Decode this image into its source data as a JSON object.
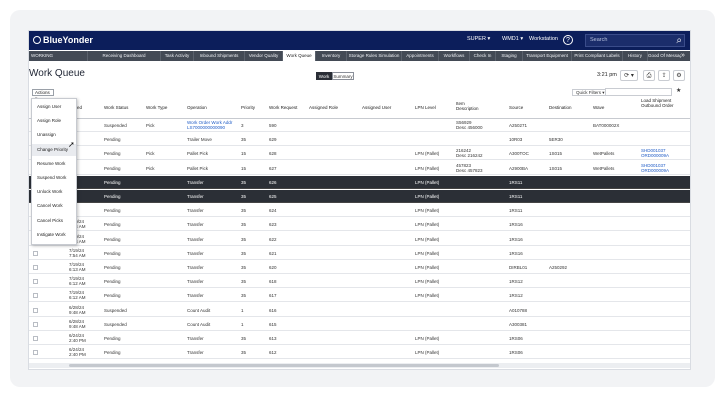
{
  "topbar": {
    "logo": "BlueYonder",
    "user": "SUPER ▾",
    "warehouse": "WMD1 ▾",
    "workstation": "Workstation",
    "help": "?",
    "search_placeholder": "Search"
  },
  "nav": {
    "left_label": "WORKING",
    "tabs": [
      "Receiving Dashboard",
      "Task Activity",
      "Inbound Shipments",
      "Vendor Quality",
      "Work Queue",
      "Inventory",
      "Storage Rules Simulation",
      "Appointments",
      "Workflows",
      "Check In",
      "Staging",
      "Transport Equipment",
      "Print Compliant Labels",
      "History",
      "Good Of Message"
    ],
    "active_tab": "Work Queue",
    "more": "»"
  },
  "page": {
    "title": "Work Queue",
    "view_work": "Work",
    "view_summary": "Summary",
    "time": "3:21 pm",
    "actions_label": "Actions ▾",
    "quick_filters": "Quick Filters ▾"
  },
  "columns": [
    "Added",
    "Work Status",
    "Work Type",
    "Operation",
    "Priority",
    "Work Request",
    "Assigned Role",
    "Assigned User",
    "LPN Level",
    "Item Description",
    "Source",
    "Destination",
    "Wave",
    "Load Shipment Outbound Order"
  ],
  "actions_menu": [
    "Assign User",
    "Assign Role",
    "Unassign",
    "Change Priority",
    "Resume Work",
    "Suspend Work",
    "Unlock Work",
    "Cancel Work",
    "Cancel Picks",
    "Instigate Work"
  ],
  "rows": [
    {
      "added": "PM",
      "status": "Suspended",
      "type": "Pick",
      "operation": "Work Order Work Addr",
      "operation2": "LS7000000000090",
      "priority": "3",
      "request": "590",
      "lpn": "",
      "item": "S56929",
      "item2": "Desc 456000",
      "source": "A250271",
      "dest": "",
      "wave": "BAT000002X",
      "order": "",
      "order2": "",
      "selected": false
    },
    {
      "added": "PM",
      "status": "Pending",
      "type": "",
      "operation": "Trailer Move",
      "operation2": "",
      "priority": "35",
      "request": "629",
      "lpn": "",
      "item": "",
      "item2": "",
      "source": "10R03",
      "dest": "5ER30",
      "wave": "",
      "order": "",
      "order2": "",
      "selected": false
    },
    {
      "added": "M",
      "status": "Pending",
      "type": "Pick",
      "operation": "Pallet Pick",
      "operation2": "",
      "priority": "15",
      "request": "628",
      "lpn": "LPN (Pallet)",
      "item": "216242",
      "item2": "Desc 216242",
      "source": "A300TOC",
      "dest": "1S015",
      "wave": "WetPallets",
      "order": "SHD001037",
      "order2": "ORD000009A",
      "selected": false
    },
    {
      "added": "M",
      "status": "Pending",
      "type": "Pick",
      "operation": "Pallet Pick",
      "operation2": "",
      "priority": "15",
      "request": "627",
      "lpn": "LPN (Pallet)",
      "item": "457823",
      "item2": "Desc 457823",
      "source": "A2900BA",
      "dest": "1S015",
      "wave": "WetPallets",
      "order": "SHD001037",
      "order2": "ORD000009A",
      "selected": false
    },
    {
      "added": "M",
      "status": "Pending",
      "type": "",
      "operation": "Transfer",
      "operation2": "",
      "priority": "35",
      "request": "626",
      "lpn": "LPN (Pallet)",
      "item": "",
      "item2": "",
      "source": "1RS11",
      "dest": "",
      "wave": "",
      "order": "",
      "order2": "",
      "selected": true
    },
    {
      "added": "M",
      "status": "Pending",
      "type": "",
      "operation": "Transfer",
      "operation2": "",
      "priority": "35",
      "request": "625",
      "lpn": "LPN (Pallet)",
      "item": "",
      "item2": "",
      "source": "1RS11",
      "dest": "",
      "wave": "",
      "order": "",
      "order2": "",
      "selected": true
    },
    {
      "added": "M",
      "status": "Pending",
      "type": "",
      "operation": "Transfer",
      "operation2": "",
      "priority": "35",
      "request": "624",
      "lpn": "LPN (Pallet)",
      "item": "",
      "item2": "",
      "source": "1RS11",
      "dest": "",
      "wave": "",
      "order": "",
      "order2": "",
      "selected": false
    },
    {
      "added": "7/19/24",
      "added2": "7:54 AM",
      "status": "Pending",
      "type": "",
      "operation": "Transfer",
      "operation2": "",
      "priority": "35",
      "request": "623",
      "lpn": "LPN (Pallet)",
      "item": "",
      "item2": "",
      "source": "1RS16",
      "dest": "",
      "wave": "",
      "order": "",
      "order2": "",
      "selected": false
    },
    {
      "added": "7/19/24",
      "added2": "7:54 AM",
      "status": "Pending",
      "type": "",
      "operation": "Transfer",
      "operation2": "",
      "priority": "35",
      "request": "622",
      "lpn": "LPN (Pallet)",
      "item": "",
      "item2": "",
      "source": "1RS16",
      "dest": "",
      "wave": "",
      "order": "",
      "order2": "",
      "selected": false
    },
    {
      "added": "7/19/24",
      "added2": "7:54 AM",
      "status": "Pending",
      "type": "",
      "operation": "Transfer",
      "operation2": "",
      "priority": "35",
      "request": "621",
      "lpn": "LPN (Pallet)",
      "item": "",
      "item2": "",
      "source": "1RS16",
      "dest": "",
      "wave": "",
      "order": "",
      "order2": "",
      "selected": false
    },
    {
      "added": "7/19/24",
      "added2": "6:13 AM",
      "status": "Pending",
      "type": "",
      "operation": "Transfer",
      "operation2": "",
      "priority": "35",
      "request": "620",
      "lpn": "LPN (Pallet)",
      "item": "",
      "item2": "",
      "source": "DIRBL01",
      "dest": "A250292",
      "wave": "",
      "order": "",
      "order2": "",
      "selected": false
    },
    {
      "added": "7/19/24",
      "added2": "6:12 AM",
      "status": "Pending",
      "type": "",
      "operation": "Transfer",
      "operation2": "",
      "priority": "35",
      "request": "618",
      "lpn": "LPN (Pallet)",
      "item": "",
      "item2": "",
      "source": "1RS12",
      "dest": "",
      "wave": "",
      "order": "",
      "order2": "",
      "selected": false
    },
    {
      "added": "7/19/24",
      "added2": "6:12 AM",
      "status": "Pending",
      "type": "",
      "operation": "Transfer",
      "operation2": "",
      "priority": "35",
      "request": "617",
      "lpn": "LPN (Pallet)",
      "item": "",
      "item2": "",
      "source": "1RS12",
      "dest": "",
      "wave": "",
      "order": "",
      "order2": "",
      "selected": false
    },
    {
      "added": "6/28/24",
      "added2": "9:48 AM",
      "status": "Suspended",
      "type": "",
      "operation": "Count Audit",
      "operation2": "",
      "priority": "1",
      "request": "616",
      "lpn": "",
      "item": "",
      "item2": "",
      "source": "A010788",
      "dest": "",
      "wave": "",
      "order": "",
      "order2": "",
      "selected": false
    },
    {
      "added": "6/28/24",
      "added2": "9:48 AM",
      "status": "Suspended",
      "type": "",
      "operation": "Count Audit",
      "operation2": "",
      "priority": "1",
      "request": "615",
      "lpn": "",
      "item": "",
      "item2": "",
      "source": "A300381",
      "dest": "",
      "wave": "",
      "order": "",
      "order2": "",
      "selected": false
    },
    {
      "added": "6/24/24",
      "added2": "2:40 PM",
      "status": "Pending",
      "type": "",
      "operation": "Transfer",
      "operation2": "",
      "priority": "35",
      "request": "613",
      "lpn": "LPN (Pallet)",
      "item": "",
      "item2": "",
      "source": "1RS06",
      "dest": "",
      "wave": "",
      "order": "",
      "order2": "",
      "selected": false
    },
    {
      "added": "6/24/24",
      "added2": "2:40 PM",
      "status": "Pending",
      "type": "",
      "operation": "Transfer",
      "operation2": "",
      "priority": "35",
      "request": "612",
      "lpn": "LPN (Pallet)",
      "item": "",
      "item2": "",
      "source": "1RS06",
      "dest": "",
      "wave": "",
      "order": "",
      "order2": "",
      "selected": false
    }
  ],
  "highlighted_menu_item": "Change Priority"
}
